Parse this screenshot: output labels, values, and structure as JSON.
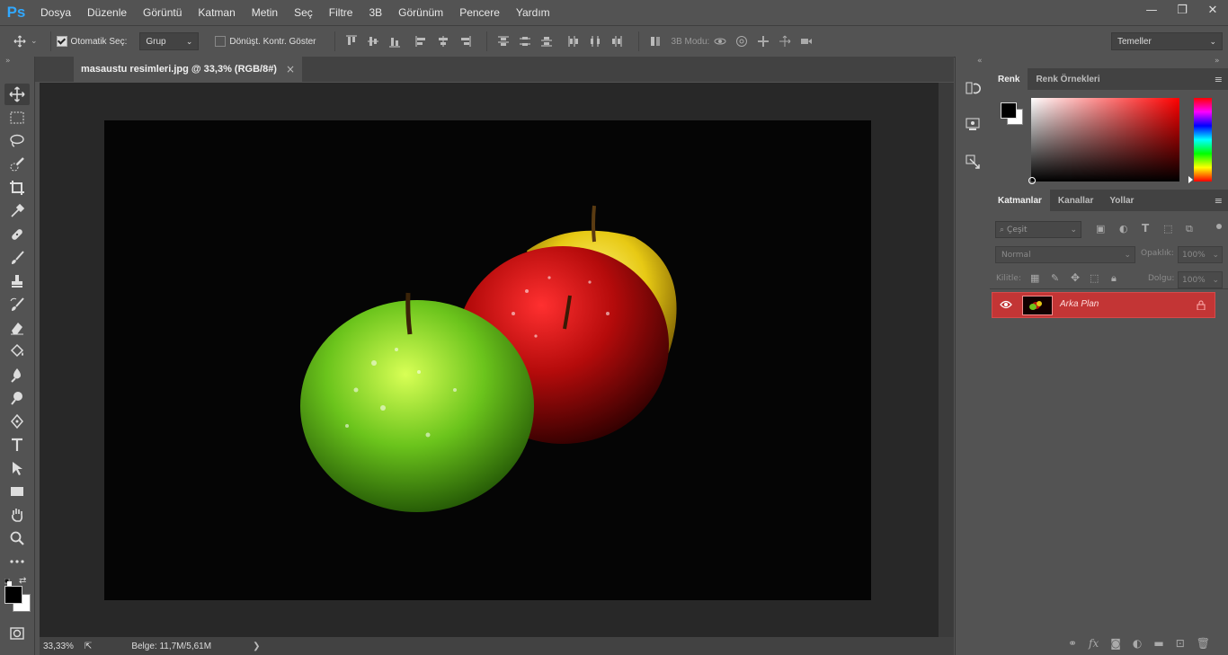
{
  "app": {
    "logo": "Ps"
  },
  "menu": [
    "Dosya",
    "Düzenle",
    "Görüntü",
    "Katman",
    "Metin",
    "Seç",
    "Filtre",
    "3B",
    "Görünüm",
    "Pencere",
    "Yardım"
  ],
  "window_controls": {
    "minimize": "—",
    "restore": "❐",
    "close": "✕"
  },
  "options": {
    "auto_select_label": "Otomatik Seç:",
    "auto_select_checked": true,
    "auto_select_value": "Grup",
    "transform_controls_label": "Dönüşt. Kontr. Göster",
    "transform_controls_checked": false,
    "mode_3d_label": "3B Modu:",
    "workspace": "Temeller"
  },
  "document": {
    "tab_title": "masaustu resimleri.jpg @ 33,3% (RGB/8#)",
    "close": "×",
    "zoom": "33,33%",
    "doc_info": "Belge: 11,7M/5,61M",
    "arrow": "❯"
  },
  "panels": {
    "color_tabs": [
      "Renk",
      "Renk Örnekleri"
    ],
    "layer_tabs": [
      "Katmanlar",
      "Kanallar",
      "Yollar"
    ],
    "filter_placeholder": "Çeşit",
    "blend_mode": "Normal",
    "opacity_label": "Opaklık:",
    "opacity_value": "100%",
    "lock_label": "Kilitle:",
    "fill_label": "Dolgu:",
    "fill_value": "100%",
    "layers": [
      {
        "name": "Arka Plan",
        "visible": true,
        "locked": true
      }
    ]
  },
  "colors": {
    "foreground": "#000000",
    "background": "#ffffff",
    "layer_selected": "#c33535"
  }
}
